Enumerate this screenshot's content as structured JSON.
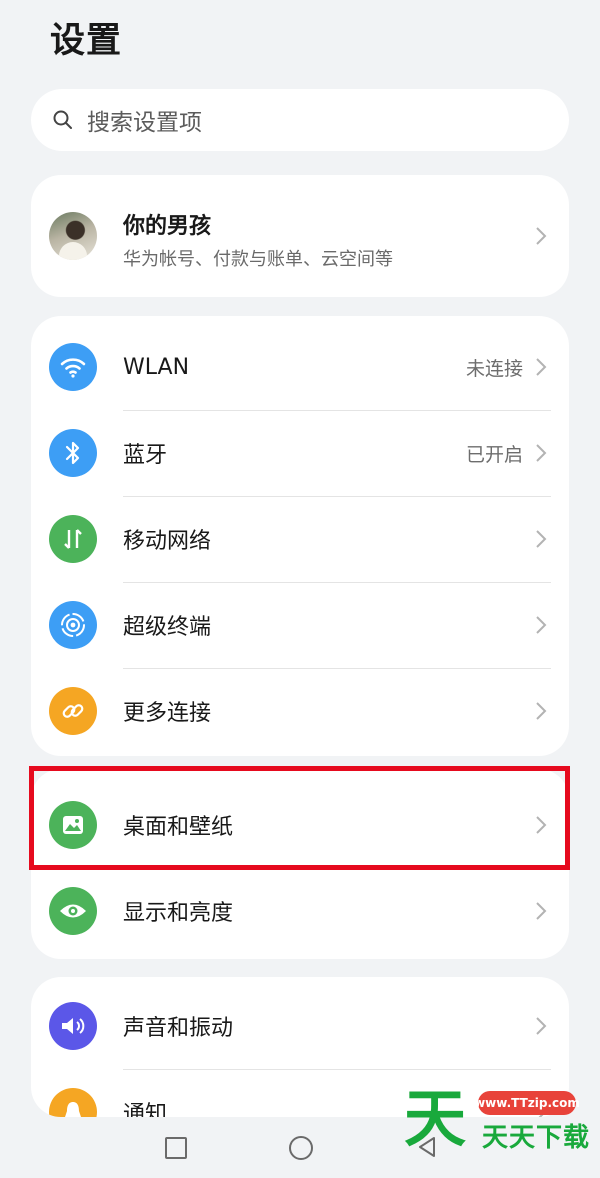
{
  "header": {
    "title": "设置"
  },
  "search": {
    "placeholder": "搜索设置项"
  },
  "account": {
    "name": "你的男孩",
    "subtitle": "华为帐号、付款与账单、云空间等"
  },
  "connectivity": [
    {
      "label": "WLAN",
      "status": "未连接",
      "icon": "wifi-icon",
      "color": "#3d9ef5"
    },
    {
      "label": "蓝牙",
      "status": "已开启",
      "icon": "bluetooth-icon",
      "color": "#3d9ef5"
    },
    {
      "label": "移动网络",
      "status": "",
      "icon": "mobile-data-icon",
      "color": "#4cb35a"
    },
    {
      "label": "超级终端",
      "status": "",
      "icon": "super-device-icon",
      "color": "#3d9ef5"
    },
    {
      "label": "更多连接",
      "status": "",
      "icon": "link-icon",
      "color": "#f5a623"
    }
  ],
  "display": [
    {
      "label": "桌面和壁纸",
      "icon": "wallpaper-icon",
      "color": "#4cb35a"
    },
    {
      "label": "显示和亮度",
      "icon": "eye-icon",
      "color": "#4cb35a"
    }
  ],
  "sound": [
    {
      "label": "声音和振动",
      "icon": "speaker-icon",
      "color": "#5b57e8"
    },
    {
      "label": "通知",
      "icon": "bell-icon",
      "color": "#f5a623"
    }
  ],
  "highlight_color": "#e60a1e",
  "watermark": {
    "big": "天",
    "url": "www.TTzip.com",
    "text": "天天下载"
  }
}
